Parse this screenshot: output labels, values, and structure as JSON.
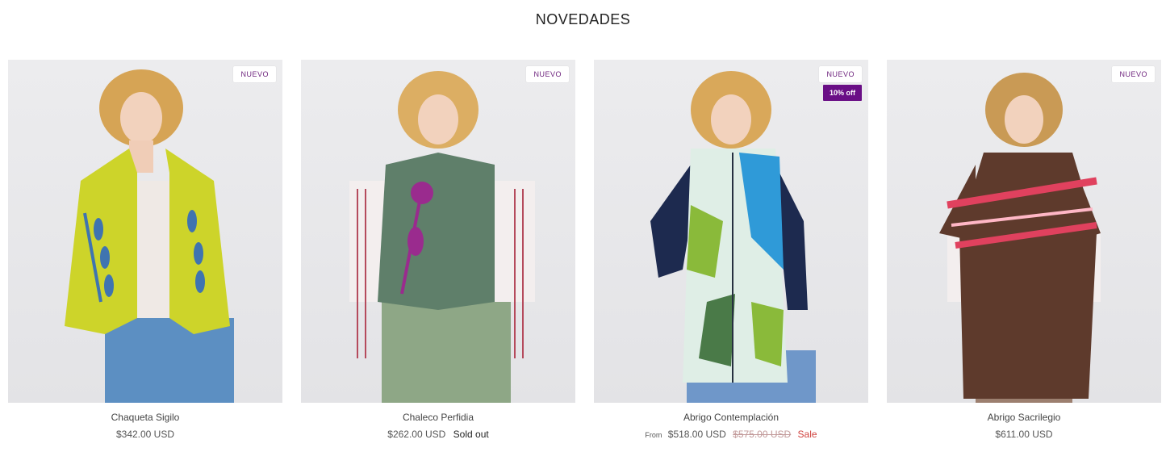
{
  "section": {
    "title": "NOVEDADES"
  },
  "products": [
    {
      "name": "Chaqueta Sigilo",
      "badge": "NUEVO",
      "price": "$342.00 USD",
      "colors": {
        "top": "#cdd42a",
        "accent": "#3f74b0",
        "bottom": "#5c8fc2",
        "hair": "#d6a455"
      }
    },
    {
      "name": "Chaleco Perfidia",
      "badge": "NUEVO",
      "price": "$262.00 USD",
      "status": "Sold out",
      "colors": {
        "top": "#5f7f6a",
        "accent": "#9a2b8e",
        "bottom": "#8ea786",
        "hair": "#dcae63"
      }
    },
    {
      "name": "Abrigo Contemplación",
      "badge": "NUEVO",
      "discount": "10% off",
      "from_label": "From",
      "price": "$518.00 USD",
      "compare_price": "$575.00 USD",
      "sale_label": "Sale",
      "colors": {
        "top": "#dfeee6",
        "accent": "#2f9ad8",
        "bottom": "#6f97c9",
        "hair": "#d9a85a"
      }
    },
    {
      "name": "Abrigo Sacrilegio",
      "badge": "NUEVO",
      "price": "$611.00 USD",
      "colors": {
        "top": "#5e3a2c",
        "accent": "#e0415e",
        "bottom": "#9c7f6f",
        "hair": "#c99a55"
      }
    }
  ]
}
